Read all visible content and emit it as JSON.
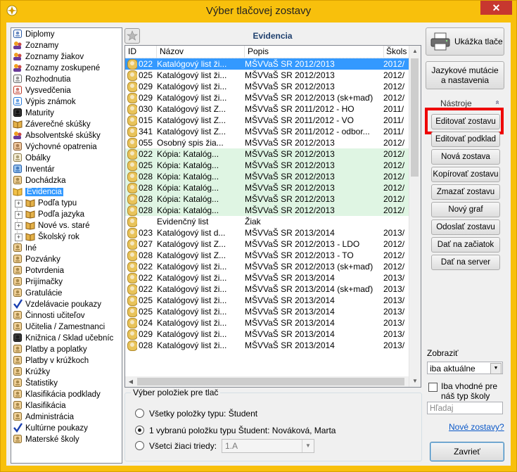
{
  "window": {
    "title": "Výber tlačovej zostavy",
    "close_label": "✕"
  },
  "tree": {
    "items": [
      {
        "label": "Diplomy",
        "icon": "diploma-icon",
        "level": 0
      },
      {
        "label": "Zoznamy",
        "icon": "people-icon",
        "level": 0
      },
      {
        "label": "Zoznamy žiakov",
        "icon": "people-icon",
        "level": 0
      },
      {
        "label": "Zoznamy zoskupené",
        "icon": "people-icon",
        "level": 0
      },
      {
        "label": "Rozhodnutia",
        "icon": "document-icon",
        "level": 0
      },
      {
        "label": "Vysvedčenia",
        "icon": "certificate-icon",
        "level": 0
      },
      {
        "label": "Výpis známok",
        "icon": "grades-icon",
        "level": 0
      },
      {
        "label": "Maturity",
        "icon": "graduation-icon",
        "level": 0
      },
      {
        "label": "Záverečné skúšky",
        "icon": "book-icon",
        "level": 0
      },
      {
        "label": "Absolventské skúšky",
        "icon": "people-icon",
        "level": 0
      },
      {
        "label": "Výchovné opatrenia",
        "icon": "hand-icon",
        "level": 0
      },
      {
        "label": "Obálky",
        "icon": "envelope-icon",
        "level": 0
      },
      {
        "label": "Inventár",
        "icon": "inventory-icon",
        "level": 0
      },
      {
        "label": "Dochádzka",
        "icon": "person-icon",
        "level": 0
      },
      {
        "label": "Evidencia",
        "icon": "folder-book-icon",
        "level": 0,
        "selected": true
      },
      {
        "label": "Podľa typu",
        "icon": "book-icon",
        "level": 1,
        "expander": "+"
      },
      {
        "label": "Podľa jazyka",
        "icon": "book-icon",
        "level": 1,
        "expander": "+"
      },
      {
        "label": "Nové vs. staré",
        "icon": "book-icon",
        "level": 1,
        "expander": "+"
      },
      {
        "label": "Školský rok",
        "icon": "book-icon",
        "level": 1,
        "expander": "+"
      },
      {
        "label": "Iné",
        "icon": "person-icon",
        "level": 0
      },
      {
        "label": "Pozvánky",
        "icon": "person-icon",
        "level": 0
      },
      {
        "label": "Potvrdenia",
        "icon": "person-icon",
        "level": 0
      },
      {
        "label": "Prijímačky",
        "icon": "person-icon",
        "level": 0
      },
      {
        "label": "Gratulácie",
        "icon": "person-icon",
        "level": 0
      },
      {
        "label": "Vzdelávacie poukazy",
        "icon": "check-icon",
        "level": 0
      },
      {
        "label": "Činnosti učiteľov",
        "icon": "person-icon",
        "level": 0
      },
      {
        "label": "Učitelia / Zamestnanci",
        "icon": "person-icon",
        "level": 0
      },
      {
        "label": "Knižnica / Sklad učebníc",
        "icon": "library-icon",
        "level": 0
      },
      {
        "label": "Platby a poplatky",
        "icon": "person-icon",
        "level": 0
      },
      {
        "label": "Platby v krúžkoch",
        "icon": "person-icon",
        "level": 0
      },
      {
        "label": "Krúžky",
        "icon": "person-icon",
        "level": 0
      },
      {
        "label": "Štatistiky",
        "icon": "person-icon",
        "level": 0
      },
      {
        "label": "Klasifikácia podklady",
        "icon": "person-icon",
        "level": 0
      },
      {
        "label": "Klasifikácia",
        "icon": "person-icon",
        "level": 0
      },
      {
        "label": "Administrácia",
        "icon": "person-icon",
        "level": 0
      },
      {
        "label": "Kultúrne poukazy",
        "icon": "check-icon",
        "level": 0
      },
      {
        "label": "Materské školy",
        "icon": "person-icon",
        "level": 0
      }
    ]
  },
  "main": {
    "header": "Evidencia",
    "columns": [
      "ID",
      "Názov",
      "Popis",
      "Škols"
    ],
    "rows": [
      {
        "id": "022",
        "name": "Katalógový list ži...",
        "desc": "MŠVVaŠ SR 2012/2013",
        "school": "2012/",
        "style": "sel",
        "icon": true
      },
      {
        "id": "025",
        "name": "Katalógový list ži...",
        "desc": "MŠVVaŠ SR 2012/2013",
        "school": "2012/",
        "style": "",
        "icon": true
      },
      {
        "id": "029",
        "name": "Katalógový list ži...",
        "desc": "MŠVVaŠ SR 2012/2013",
        "school": "2012/",
        "style": "",
        "icon": true
      },
      {
        "id": "029",
        "name": "Katalógový list ži...",
        "desc": "MŠVVaŠ SR 2012/2013 (sk+maď)",
        "school": "2012/",
        "style": "",
        "icon": true
      },
      {
        "id": "030",
        "name": "Katalógový list Z...",
        "desc": "MŠVVaŠ SR 2011/2012 - HO",
        "school": "2011/",
        "style": "",
        "icon": true
      },
      {
        "id": "015",
        "name": "Katalógový list Z...",
        "desc": "MŠVVaŠ SR 2011/2012 - VO",
        "school": "2011/",
        "style": "",
        "icon": true
      },
      {
        "id": "341",
        "name": "Katalógový list Z...",
        "desc": "MŠVVaŠ SR 2011/2012 - odbor...",
        "school": "2011/",
        "style": "",
        "icon": true
      },
      {
        "id": "055",
        "name": "Osobný spis žia...",
        "desc": "MŠVVaŠ SR 2012/2013",
        "school": "2012/",
        "style": "",
        "icon": true
      },
      {
        "id": "022",
        "name": "Kópia: Katalóg...",
        "desc": "MŠVVaŠ SR 2012/2013",
        "school": "2012/",
        "style": "green",
        "icon": true
      },
      {
        "id": "025",
        "name": "Kópia: Katalóg...",
        "desc": "MŠVVaŠ SR 2012/2013",
        "school": "2012/",
        "style": "green",
        "icon": true
      },
      {
        "id": "028",
        "name": "Kópia: Katalóg...",
        "desc": "MŠVVaŠ SR 2012/2013",
        "school": "2012/",
        "style": "green",
        "icon": true
      },
      {
        "id": "028",
        "name": "Kópia: Katalóg...",
        "desc": "MŠVVaŠ SR 2012/2013",
        "school": "2012/",
        "style": "green",
        "icon": true
      },
      {
        "id": "028",
        "name": "Kópia: Katalóg...",
        "desc": "MŠVVaŠ SR 2012/2013",
        "school": "2012/",
        "style": "green",
        "icon": true
      },
      {
        "id": "028",
        "name": "Kópia: Katalóg...",
        "desc": "MŠVVaŠ SR 2012/2013",
        "school": "2012/",
        "style": "green",
        "icon": true
      },
      {
        "id": "",
        "name": "Evidenčný list",
        "desc": "Žiak",
        "school": "",
        "style": "",
        "icon": true
      },
      {
        "id": "023",
        "name": "Katalógový list d...",
        "desc": "MŠVVaŠ SR 2013/2014",
        "school": "2013/",
        "style": "",
        "icon": true
      },
      {
        "id": "027",
        "name": "Katalógový list Z...",
        "desc": "MŠVVaŠ SR 2012/2013 - LDO",
        "school": "2012/",
        "style": "",
        "icon": true
      },
      {
        "id": "028",
        "name": "Katalógový list Z...",
        "desc": "MŠVVaŠ SR 2012/2013 - TO",
        "school": "2012/",
        "style": "",
        "icon": true
      },
      {
        "id": "022",
        "name": "Katalógový list ži...",
        "desc": "MŠVVaŠ SR 2012/2013 (sk+maď)",
        "school": "2012/",
        "style": "",
        "icon": true
      },
      {
        "id": "022",
        "name": "Katalógový list ži...",
        "desc": "MŠVVaŠ SR 2013/2014",
        "school": "2013/",
        "style": "",
        "icon": true
      },
      {
        "id": "022",
        "name": "Katalógový list ži...",
        "desc": "MŠVVaŠ SR 2013/2014 (sk+maď)",
        "school": "2013/",
        "style": "",
        "icon": true
      },
      {
        "id": "025",
        "name": "Katalógový list ži...",
        "desc": "MŠVVaŠ SR 2013/2014",
        "school": "2013/",
        "style": "",
        "icon": true
      },
      {
        "id": "025",
        "name": "Katalógový list ži...",
        "desc": "MŠVVaŠ SR 2013/2014",
        "school": "2013/",
        "style": "",
        "icon": true
      },
      {
        "id": "024",
        "name": "Katalógový list ži...",
        "desc": "MŠVVaŠ SR 2013/2014",
        "school": "2013/",
        "style": "",
        "icon": true
      },
      {
        "id": "029",
        "name": "Katalógový list ži...",
        "desc": "MŠVVaŠ SR 2013/2014",
        "school": "2013/",
        "style": "",
        "icon": true
      },
      {
        "id": "028",
        "name": "Katalógový list ži...",
        "desc": "MŠVVaŠ SR 2013/2014",
        "school": "2013/",
        "style": "",
        "icon": true
      }
    ]
  },
  "selection": {
    "title": "Výber položiek pre tlač",
    "option_all": "Všetky položky typu: Študent",
    "option_one": "1 vybranú položku typu Študent: Nováková, Marta",
    "option_class": "Všetci žiaci triedy:",
    "class_value": "1.A",
    "selected": "option_one"
  },
  "right": {
    "preview_label": "Ukážka tlače",
    "lang_label_1": "Jazykové mutácie",
    "lang_label_2": "a nastavenia",
    "tools_label": "Nástroje",
    "tools_chevron": "»",
    "buttons": [
      "Editovať zostavu",
      "Editovať podklad",
      "Nová zostava",
      "Kopírovať zostavu",
      "Zmazať zostavu",
      "Nový graf",
      "Odoslať zostavu",
      "Dať na začiatok",
      "Dať na server"
    ],
    "show_label": "Zobraziť",
    "show_value": "iba aktuálne",
    "checkbox_label": "Iba vhodné pre náš typ školy",
    "search_placeholder": "Hľadaj",
    "new_reports_link": "Nové zostavy?",
    "close_label": "Zavrieť"
  },
  "colors": {
    "accent": "#3399ff",
    "highlight": "#e00000",
    "window_frame": "#f8c00c",
    "new_row": "#dff5e3"
  }
}
